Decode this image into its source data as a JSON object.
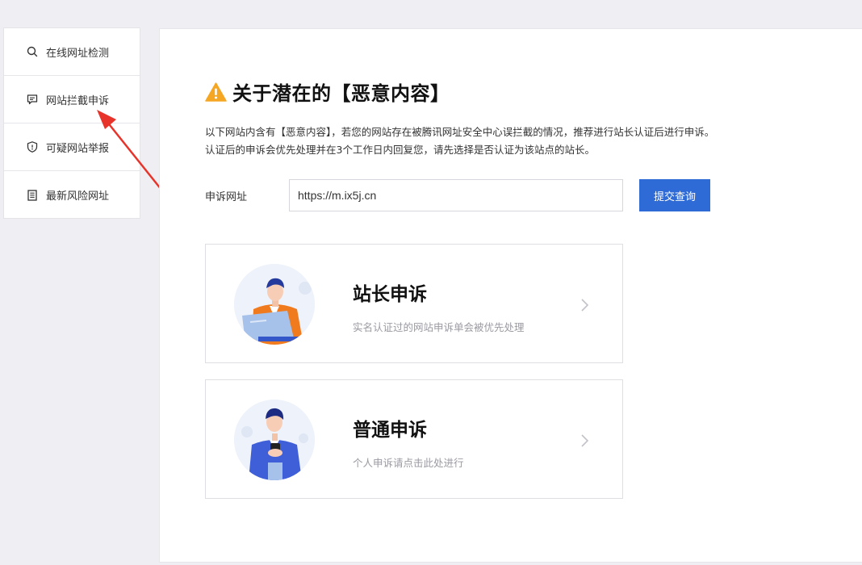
{
  "sidebar": {
    "items": [
      {
        "label": "在线网址检测",
        "icon": "search-icon"
      },
      {
        "label": "网站拦截申诉",
        "icon": "comment-icon"
      },
      {
        "label": "可疑网站举报",
        "icon": "shield-icon"
      },
      {
        "label": "最新风险网址",
        "icon": "list-icon"
      }
    ]
  },
  "main": {
    "title": "关于潜在的【恶意内容】",
    "desc_line1": "以下网站内含有【恶意内容】，若您的网站存在被腾讯网址安全中心误拦截的情况，推荐进行站长认证后进行申诉。",
    "desc_line2": "认证后的申诉会优先处理并在3个工作日内回复您，请先选择是否认证为该站点的站长。",
    "form": {
      "label": "申诉网址",
      "value": "https://m.ix5j.cn",
      "submit_label": "提交查询"
    },
    "cards": [
      {
        "title": "站长申诉",
        "subtitle": "实名认证过的网站申诉单会被优先处理"
      },
      {
        "title": "普通申诉",
        "subtitle": "个人申诉请点击此处进行"
      }
    ]
  },
  "colors": {
    "accent": "#2e6bd6",
    "warning": "#f5a623",
    "annotation": "#e8332a"
  }
}
